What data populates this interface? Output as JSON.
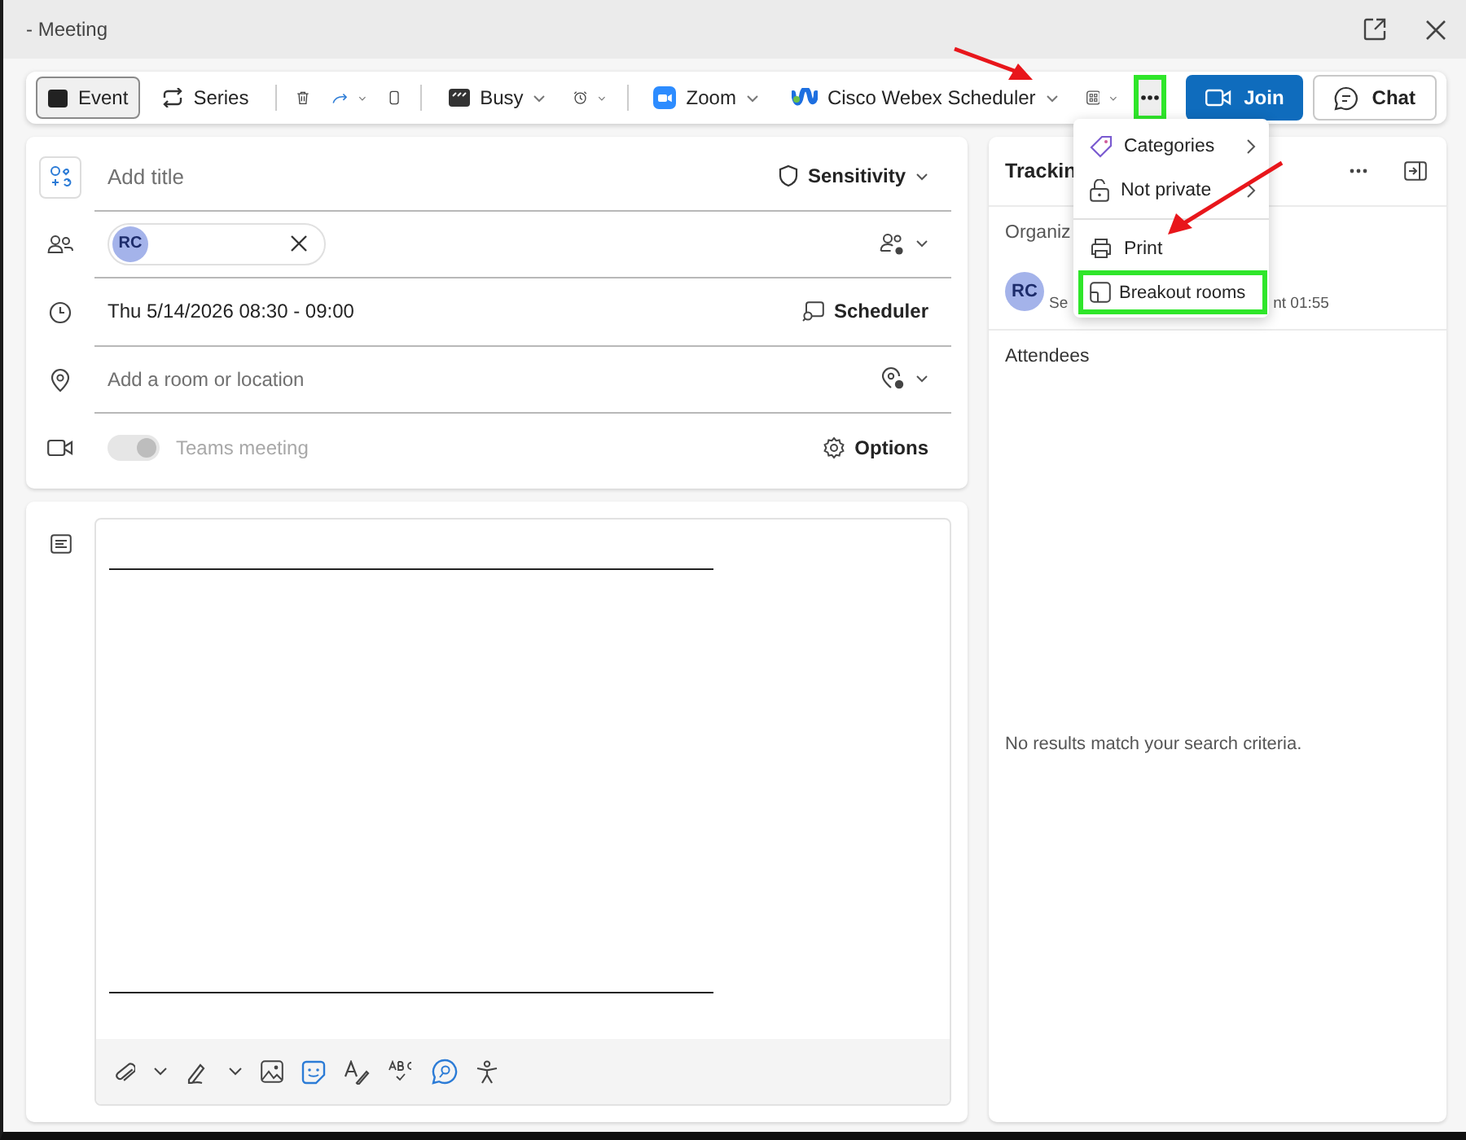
{
  "window": {
    "title": "- Meeting"
  },
  "toolbar": {
    "views": [
      {
        "label": "Event",
        "selected": true
      },
      {
        "label": "Series",
        "selected": false
      }
    ],
    "status": "Busy",
    "addins": [
      "Zoom",
      "Cisco Webex Scheduler"
    ],
    "more_highlighted": true,
    "join": "Join",
    "chat": "Chat"
  },
  "form": {
    "title_placeholder": "Add title",
    "sensitivity": "Sensitivity",
    "attendee": "RC",
    "datetime": "Thu 5/14/2026 08:30 - 09:00",
    "scheduler": "Scheduler",
    "location_placeholder": "Add a room or location",
    "teams": {
      "label": "Teams meeting",
      "on": true,
      "disabled": true
    },
    "options": "Options"
  },
  "tracking": {
    "title": "Trackin",
    "organizer_label": "Organiz",
    "organizer": {
      "initials": "RC",
      "status_start": "Se",
      "status_end": "nt 01:55"
    },
    "attendees_label": "Attendees",
    "empty": "No results match your search criteria."
  },
  "menu": {
    "items": [
      {
        "kind": "submenu",
        "label": "Categories",
        "highlighted": false
      },
      {
        "kind": "submenu",
        "label": "Not private",
        "highlighted": false
      },
      {
        "kind": "divider"
      },
      {
        "kind": "action",
        "label": "Print",
        "highlighted": false
      },
      {
        "kind": "action",
        "label": "Breakout rooms",
        "highlighted": true
      }
    ]
  }
}
